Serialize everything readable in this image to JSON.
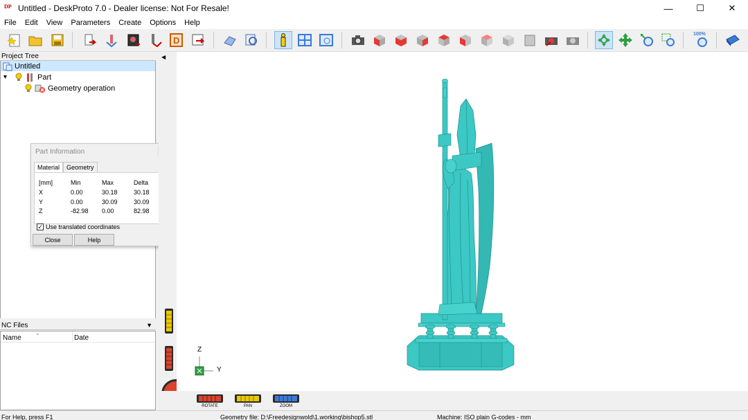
{
  "window": {
    "title": "Untitled - DeskProto 7.0 - Dealer license: Not For Resale!",
    "logo_text": "DP",
    "controls": {
      "minimize": "—",
      "maximize": "☐",
      "close": "✕"
    }
  },
  "menu": [
    "File",
    "Edit",
    "View",
    "Parameters",
    "Create",
    "Options",
    "Help"
  ],
  "toolbar": {
    "zoom_label": "100%"
  },
  "project_tree": {
    "header": "Project Tree",
    "root": "Untitled",
    "part": "Part",
    "operation": "Geometry operation",
    "expand_glyph": "▾"
  },
  "nc_files": {
    "header": "NC Files",
    "dropdown_glyph": "▼",
    "columns": [
      "Name",
      "Date"
    ]
  },
  "part_info_dialog": {
    "title": "Part Information",
    "tabs": [
      "Material",
      "Geometry"
    ],
    "headers": [
      "[mm]",
      "Min",
      "Max",
      "Delta"
    ],
    "rows": [
      {
        "axis": "X",
        "min": "0.00",
        "max": "30.18",
        "delta": "30.18"
      },
      {
        "axis": "Y",
        "min": "0.00",
        "max": "30.09",
        "delta": "30.09"
      },
      {
        "axis": "Z",
        "min": "-82.98",
        "max": "0.00",
        "delta": "82.98"
      }
    ],
    "checkbox_label": "Use translated coordinates",
    "checkbox_checked": true,
    "close_button": "Close",
    "help_button": "Help",
    "more_glyph": "▼"
  },
  "viewport": {
    "collapse_glyph": "◀",
    "axes": {
      "z": "Z",
      "y": "Y",
      "x": "x"
    },
    "model_color": "#3cc8c4",
    "controls": [
      "ROTATE",
      "PAN",
      "ZOOM"
    ]
  },
  "status": {
    "help": "For Help, press F1",
    "geometry_file": "Geometry file: D:\\Freedesignwold\\1.working\\bishop5.stl",
    "machine": "Machine: ISO plain G-codes - mm"
  }
}
